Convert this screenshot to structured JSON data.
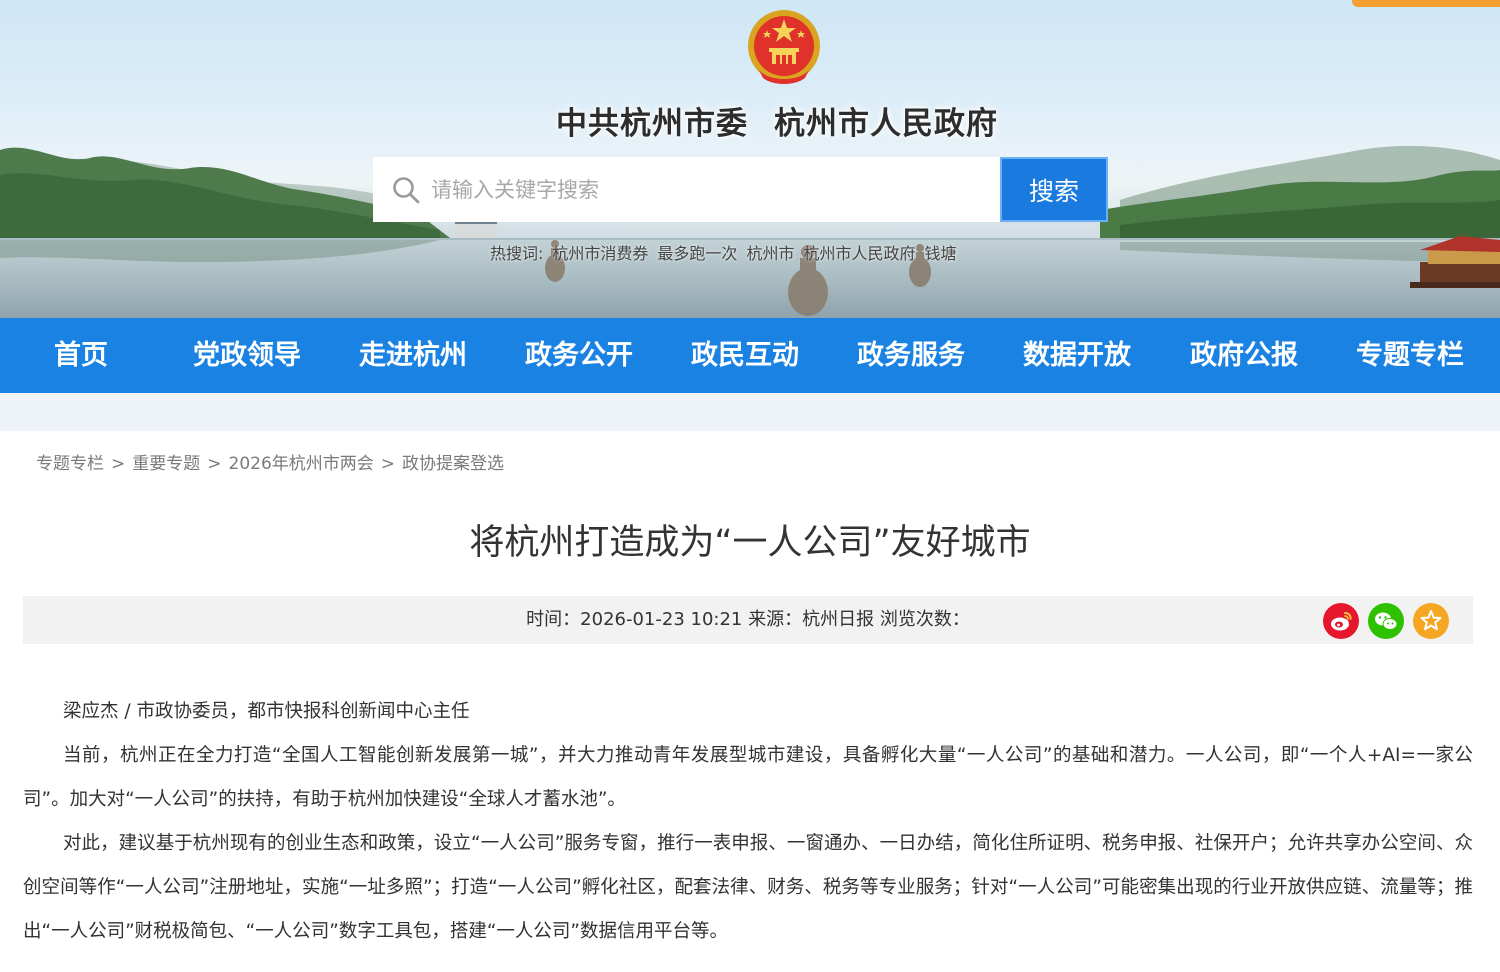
{
  "header": {
    "title_party": "中共杭州市委",
    "title_gov": "杭州市人民政府",
    "emblem": "national-emblem-icon"
  },
  "search": {
    "placeholder": "请输入关键字搜索",
    "button_label": "搜索",
    "hot_label": "热搜词:",
    "hot_words": [
      "杭州市消费券",
      "最多跑一次",
      "杭州市",
      "杭州市人民政府",
      "钱塘"
    ]
  },
  "nav": {
    "items": [
      "首页",
      "党政领导",
      "走进杭州",
      "政务公开",
      "政民互动",
      "政务服务",
      "数据开放",
      "政府公报",
      "专题专栏"
    ]
  },
  "breadcrumb": [
    "专题专栏",
    "重要专题",
    "2026年杭州市两会",
    "政协提案登选"
  ],
  "article": {
    "title": "将杭州打造成为“一人公司”友好城市",
    "meta": "时间：2026-01-23 10:21 来源：杭州日报 浏览次数：",
    "share_icons": [
      "weibo-icon",
      "wechat-icon",
      "favorite-star-icon"
    ],
    "paragraphs": [
      "梁应杰 / 市政协委员，都市快报科创新闻中心主任",
      "当前，杭州正在全力打造“全国人工智能创新发展第一城”，并大力推动青年发展型城市建设，具备孵化大量“一人公司”的基础和潜力。一人公司，即“一个人+AI=一家公司”。加大对“一人公司”的扶持，有助于杭州加快建设“全球人才蓄水池”。",
      "对此，建议基于杭州现有的创业生态和政策，设立“一人公司”服务专窗，推行一表申报、一窗通办、一日办结，简化住所证明、税务申报、社保开户；允许共享办公空间、众创空间等作“一人公司”注册地址，实施“一址多照”；打造“一人公司”孵化社区，配套法律、财务、税务等专业服务；针对“一人公司”可能密集出现的行业开放供应链、流量等；推出“一人公司”财税极简包、“一人公司”数字工具包，搭建“一人公司”数据信用平台等。"
    ]
  },
  "colors": {
    "nav_blue": "#1a82e2",
    "search_blue": "#1a7ae0",
    "accent_orange": "#f5a030",
    "weibo_red": "#e6162d",
    "wechat_green": "#2dc100",
    "star_gold": "#f5a623"
  }
}
